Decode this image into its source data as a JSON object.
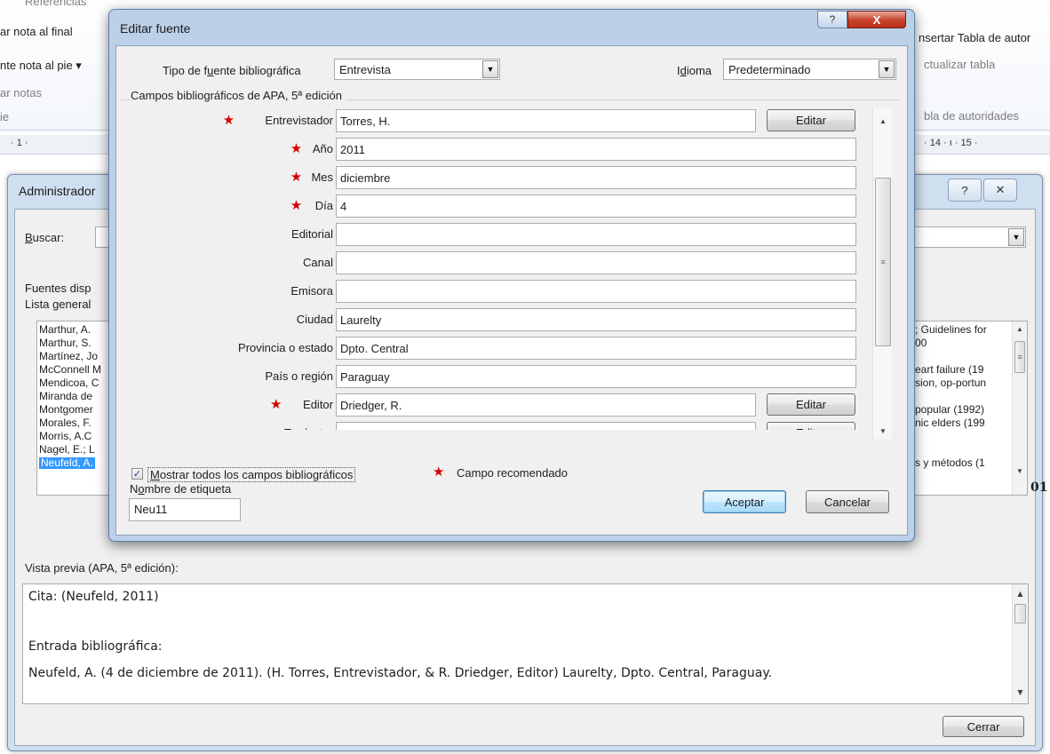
{
  "ribbon": {
    "items": [
      {
        "text": "Referencias",
        "dim": true
      },
      {
        "text": "ar nota al final",
        "dim": false
      },
      {
        "text": "nte nota al pie ▾",
        "dim": false
      },
      {
        "text": "ar notas",
        "dim": true
      },
      {
        "text": "ie",
        "dim": true
      },
      {
        "text": "nsertar Tabla de autor",
        "dim": false
      },
      {
        "text": "ctualizar tabla",
        "dim": true
      },
      {
        "text": "bla de autoridades",
        "dim": true
      }
    ],
    "ruler_left": "· 1 · ",
    "ruler_right": "· 14 · ı · 15 ·"
  },
  "manager_dialog": {
    "title": "Administrador",
    "search_label": "Buscar:",
    "available_label": "Fuentes disp",
    "master_list_label": "Lista general",
    "left_list": [
      "Marthur, A.",
      "Marthur, S.",
      "Martínez, Jo",
      "McConnell M",
      "Mendicoa, C",
      "Miranda de",
      "Montgomer",
      "Morales, F.",
      "Morris, A.C",
      "Nagel, E.; L",
      "Neufeld, A."
    ],
    "right_list": [
      "; Guidelines for",
      "00",
      "",
      "eart failure (19",
      "sion, op-portun",
      "",
      "popular (1992)",
      "nic elders (199",
      "",
      "",
      "s y métodos (1"
    ],
    "preview_label": "Vista previa (APA, 5ª edición):",
    "preview": {
      "citation": "Cita:  (Neufeld, 2011)",
      "entry_heading": "Entrada bibliográfica:",
      "entry": "Neufeld, A. (4 de diciembre de 2011). (H. Torres, Entrevistador, & R. Driedger, Editor) Laurelty, Dpto. Central, Paraguay."
    },
    "close_button": "Cerrar",
    "partial_char": "01"
  },
  "edit_dialog": {
    "title": "Editar fuente",
    "source_type_label": "Tipo de fuente bibliográfica",
    "source_type_value": "Entrevista",
    "language_label": "Idioma",
    "language_value": "Predeterminado",
    "group_title": "Campos bibliográficos de APA, 5ª edición",
    "fields": [
      {
        "label": "Entrevistador",
        "value": "Torres, H.",
        "required": true,
        "edit": true
      },
      {
        "label": "Año",
        "value": "2011",
        "required": true,
        "edit": false
      },
      {
        "label": "Mes",
        "value": "diciembre",
        "required": true,
        "edit": false
      },
      {
        "label": "Día",
        "value": "4",
        "required": true,
        "edit": false
      },
      {
        "label": "Editorial",
        "value": "",
        "required": false,
        "edit": false
      },
      {
        "label": "Canal",
        "value": "",
        "required": false,
        "edit": false
      },
      {
        "label": "Emisora",
        "value": "",
        "required": false,
        "edit": false
      },
      {
        "label": "Ciudad",
        "value": "Laurelty",
        "required": false,
        "edit": false
      },
      {
        "label": "Provincia o estado",
        "value": "Dpto. Central",
        "required": false,
        "edit": false
      },
      {
        "label": "País o región",
        "value": "Paraguay",
        "required": false,
        "edit": false
      },
      {
        "label": "Editor",
        "value": "Driedger, R.",
        "required": true,
        "edit": true
      },
      {
        "label": "Traductor",
        "value": "",
        "required": false,
        "edit": true
      }
    ],
    "edit_button_label": "Editar",
    "show_all_label": "Mostrar todos los campos bibliográficos",
    "show_all_checked": true,
    "recommended_label": "Campo recomendado",
    "tag_name_label": "Nombre de etiqueta",
    "tag_name_value": "Neu11",
    "ok_button": "Aceptar",
    "cancel_button": "Cancelar",
    "help_glyph": "?",
    "close_glyph": "X"
  },
  "colors": {
    "required_star": "#d40000",
    "selection": "#3399ff"
  }
}
